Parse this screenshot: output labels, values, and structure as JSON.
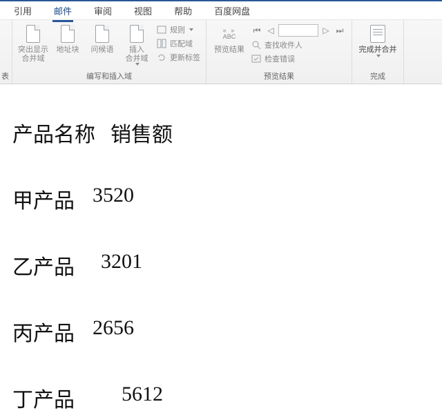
{
  "tabs": {
    "ref": "引用",
    "mail": "邮件",
    "review": "审阅",
    "view": "视图",
    "help": "帮助",
    "baidu": "百度网盘"
  },
  "ribbon": {
    "tables_trail": "表",
    "group1": {
      "highlight": "突出显示\n合并域",
      "addressblock": "地址块",
      "greeting": "问候语",
      "insertfield": "插入\n合并域",
      "rules": "规则",
      "match": "匹配域",
      "updatelabels": "更新标签",
      "label": "编写和插入域"
    },
    "group2": {
      "abc": "ABC",
      "preview": "预览结果",
      "findrecipient": "查找收件人",
      "checkerrors": "检查错误",
      "label": "预览结果"
    },
    "group3": {
      "finish": "完成并合并",
      "label": "完成"
    }
  },
  "doc": {
    "header": {
      "name": "产品名称",
      "value": "销售额"
    },
    "rows": [
      {
        "name": "甲产品",
        "value": "3520"
      },
      {
        "name": "乙产品",
        "value": "3201"
      },
      {
        "name": "丙产品",
        "value": "2656"
      },
      {
        "name": "丁产品",
        "value": "5612"
      }
    ]
  }
}
